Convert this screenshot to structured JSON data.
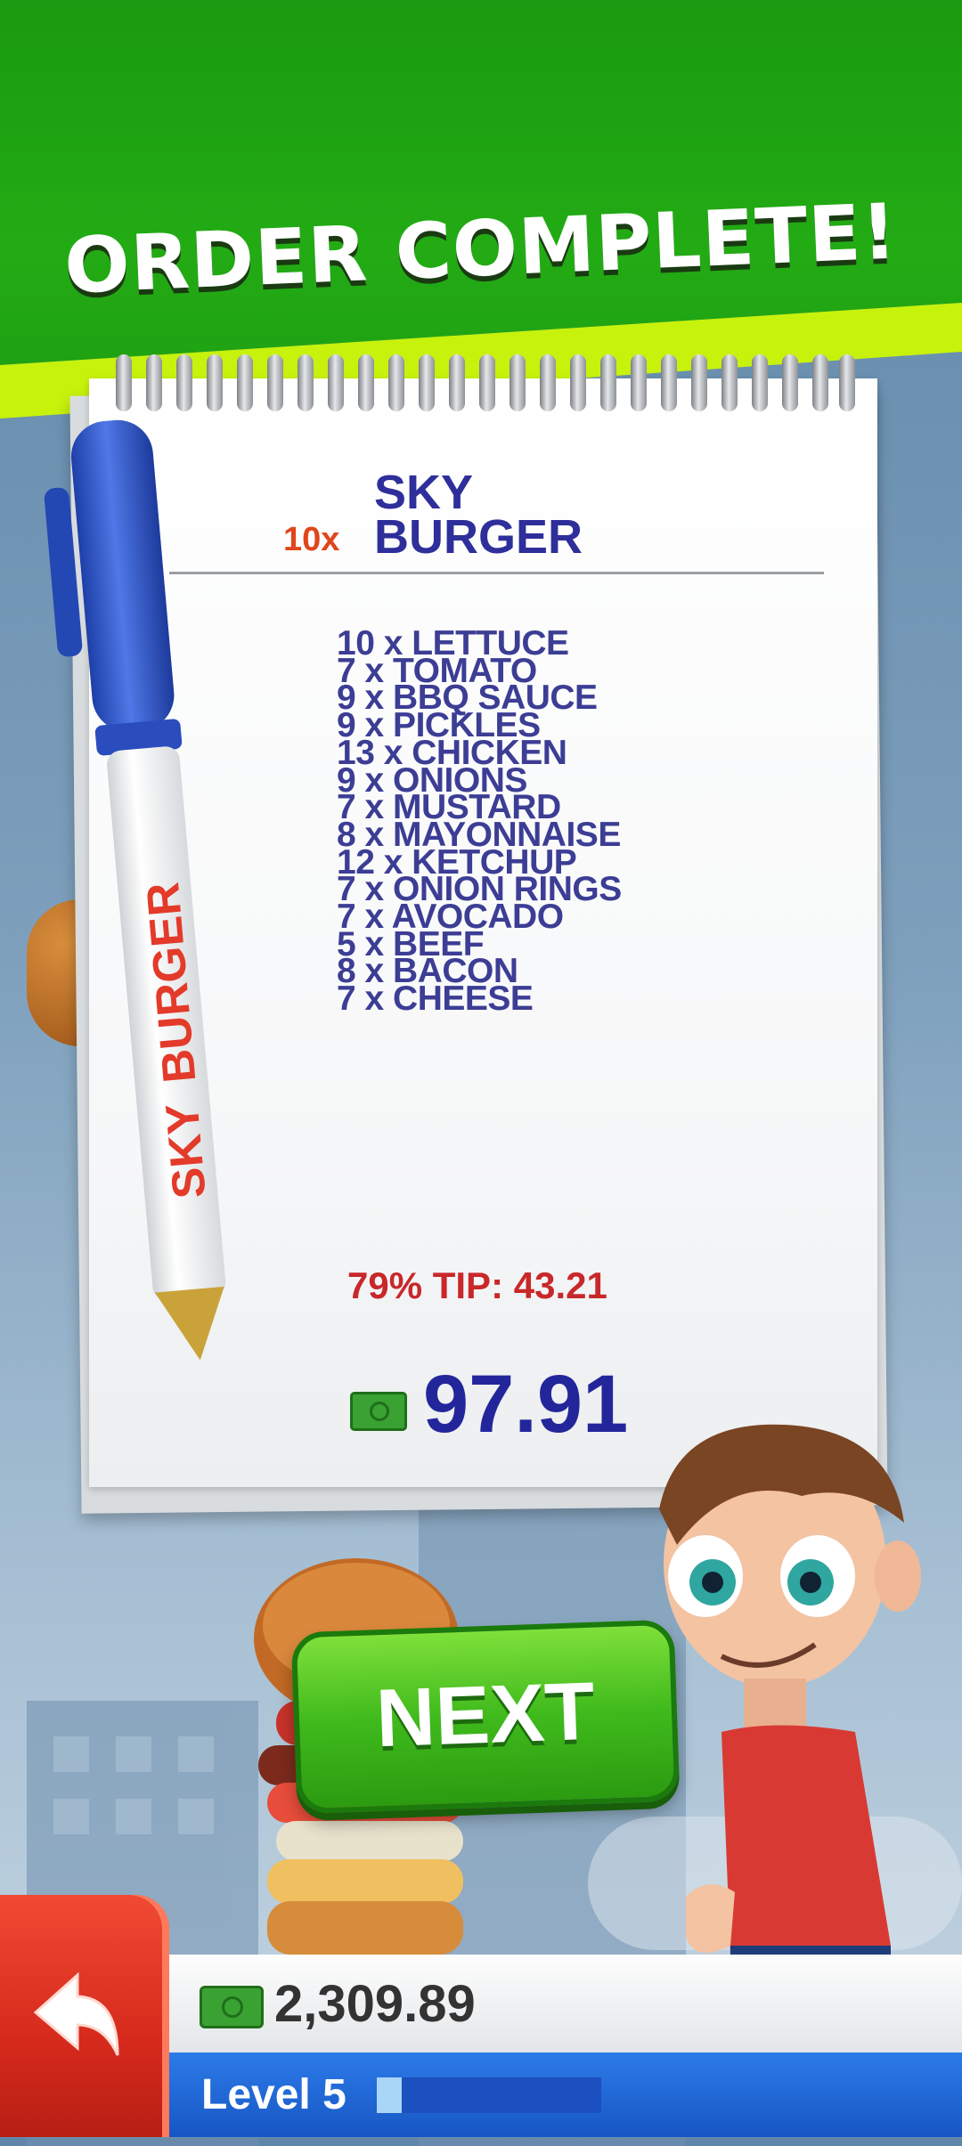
{
  "header": {
    "title": "ORDER COMPLETE!"
  },
  "order": {
    "quantity_label": "10x",
    "name_line1": "SKY",
    "name_line2": "BURGER",
    "ingredients": [
      "10 x LETTUCE",
      "7 x TOMATO",
      "9 x BBQ SAUCE",
      "9 x PICKLES",
      "13 x CHICKEN",
      "9 x ONIONS",
      "7 x MUSTARD",
      "8 x MAYONNAISE",
      "12 x KETCHUP",
      "7 x ONION RINGS",
      "7 x AVOCADO",
      "5 x BEEF",
      "8 x BACON",
      "7 x CHEESE"
    ],
    "tip_text": "79% TIP: 43.21",
    "total": "97.91"
  },
  "pen": {
    "brand_line1": "SKY",
    "brand_line2": "BURGER"
  },
  "buttons": {
    "next_label": "NEXT"
  },
  "hud": {
    "cash": "2,309.89",
    "level_label": "Level 5",
    "level_progress": 0.11
  },
  "colors": {
    "banner_green": "#23ab14",
    "banner_lime": "#c7f20c",
    "ingredient_text": "#3c3d94",
    "tip_text": "#c8282a",
    "total_text": "#23269a",
    "next_button": "#3fba1c",
    "back_button": "#d62a1c",
    "level_bar": "#1756c4"
  },
  "icons": [
    "cash-icon",
    "back-arrow-icon",
    "pen-icon"
  ]
}
